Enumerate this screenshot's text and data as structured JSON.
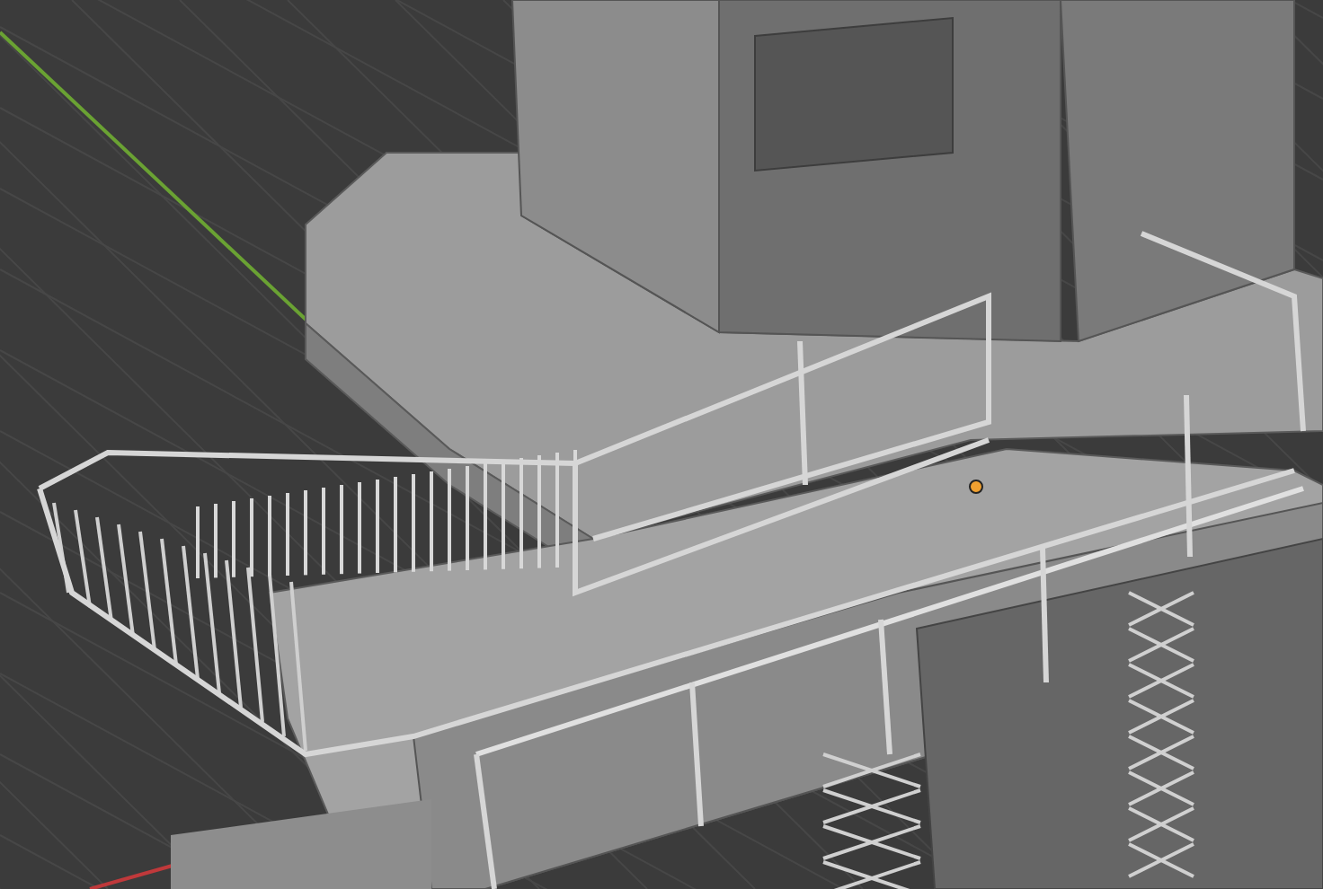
{
  "viewport": {
    "origin_marker": true
  }
}
